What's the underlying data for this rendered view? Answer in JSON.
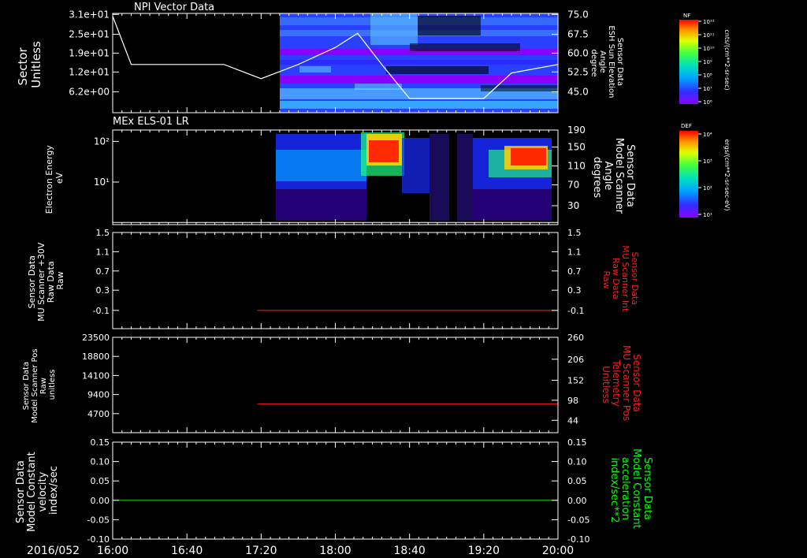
{
  "time_axis": {
    "date_label": "2016/052",
    "tick_labels": [
      "16:00",
      "16:40",
      "17:20",
      "18:00",
      "18:40",
      "19:20",
      "20:00"
    ]
  },
  "panels": [
    {
      "id": "npi",
      "title": "NPI Vector Data",
      "left_label": [
        "Sector",
        "Unitless"
      ],
      "right_label": [
        "Sensor Data",
        "ESH Sun Elevation",
        "Angle",
        "degree"
      ],
      "left_ticks": [
        "3.1e+01",
        "2.5e+01",
        "1.9e+01",
        "1.2e+01",
        "6.2e+00"
      ],
      "right_ticks": [
        "75.0",
        "67.5",
        "60.0",
        "52.5",
        "45.0"
      ],
      "colorbar": {
        "label": "NF",
        "unit": "cnts/(cm**2-sr-sec)",
        "ticks": [
          "10¹²",
          "10¹¹",
          "10¹⁰",
          "10⁹",
          "10⁸",
          "10⁷",
          "10⁶"
        ]
      }
    },
    {
      "id": "els",
      "title": "MEx ELS-01 LR",
      "left_label": [
        "Electron Energy",
        "eV"
      ],
      "right_label": [
        "Sensor Data",
        "Model Scanner",
        "Angle",
        "degrees"
      ],
      "left_ticks": [
        "10²",
        "10¹"
      ],
      "right_ticks": [
        "190",
        "150",
        "110",
        "70",
        "30"
      ],
      "colorbar": {
        "label": "DEF",
        "unit": "ergs/(cm**2-sr-sec-eV)",
        "ticks": [
          "10⁴",
          "10³",
          "10²",
          "10¹"
        ]
      }
    },
    {
      "id": "mu_int",
      "left_label": [
        "Sensor Data",
        "MU Scanner +30V",
        "Raw Data",
        "Raw"
      ],
      "right_label": [
        "Sensor Data",
        "MU Scanner Int",
        "Raw Data",
        "Raw"
      ],
      "left_ticks": [
        "1.5",
        "1.1",
        "0.7",
        "0.3",
        "-0.1"
      ],
      "right_ticks": [
        "1.5",
        "1.1",
        "0.7",
        "0.3",
        "-0.1"
      ]
    },
    {
      "id": "mu_pos",
      "left_label": [
        "Sensor Data",
        "Model Scanner Pos",
        "Raw",
        "unitless"
      ],
      "right_label": [
        "Sensor Data",
        "MU Scanner Pos",
        "Telemetry",
        "Unitless"
      ],
      "left_ticks": [
        "23500",
        "18800",
        "14100",
        "9400",
        "4700"
      ],
      "right_ticks": [
        "260",
        "206",
        "152",
        "98",
        "44"
      ]
    },
    {
      "id": "model",
      "left_label": [
        "Sensor Data",
        "Model Constant",
        "velocity",
        "index/sec"
      ],
      "right_label": [
        "Sensor Data",
        "Model Constant",
        "acceleration",
        "index/sec**2"
      ],
      "left_ticks": [
        "0.15",
        "0.10",
        "0.05",
        "0.00",
        "-0.05",
        "-0.10"
      ],
      "right_ticks": [
        "0.15",
        "0.10",
        "0.05",
        "0.00",
        "-0.05",
        "-0.10"
      ]
    }
  ],
  "colors": {
    "axes": "#ffffff",
    "red_line": "#ff2020",
    "green_line": "#00e000",
    "green_label": "#00ff00",
    "red_label": "#ff1a1a"
  },
  "chart_data": [
    {
      "type": "heatmap",
      "title": "NPI Vector Data",
      "ylabel": "Sector Unitless",
      "y2label": "Sensor Data ESH Sun Elevation Angle degree",
      "x": [
        "16:00",
        "20:00"
      ],
      "data_start": "17:22",
      "overlay_line": {
        "name": "ESH Sun Elevation Angle",
        "axis": "right",
        "ylim": [
          40,
          75
        ],
        "points": [
          [
            "16:00",
            74
          ],
          [
            "16:10",
            57
          ],
          [
            "16:30",
            57
          ],
          [
            "17:00",
            57
          ],
          [
            "17:20",
            52
          ],
          [
            "17:40",
            57
          ],
          [
            "18:00",
            63
          ],
          [
            "18:12",
            68
          ],
          [
            "18:25",
            57
          ],
          [
            "18:40",
            45
          ],
          [
            "19:20",
            45
          ],
          [
            "19:35",
            54
          ],
          [
            "20:00",
            57
          ]
        ]
      }
    },
    {
      "type": "heatmap",
      "title": "MEx ELS-01 LR",
      "ylabel": "Electron Energy eV",
      "y2label": "Sensor Data Model Scanner Angle degrees",
      "data_start": "17:20",
      "overlay_line": {
        "name": "Model Scanner Angle",
        "axis": "right",
        "ylim": [
          10,
          190
        ],
        "points": [
          [
            "16:00",
            14
          ],
          [
            "20:00",
            14
          ]
        ]
      }
    },
    {
      "type": "line",
      "ylabel": "Sensor Data MU Scanner +30V Raw Data Raw",
      "y2label": "Sensor Data MU Scanner Int Raw Data Raw",
      "ylim": [
        -0.35,
        1.5
      ],
      "series": [
        {
          "points": [
            [
              "17:18",
              0.0
            ],
            [
              "20:00",
              0.0
            ]
          ]
        }
      ]
    },
    {
      "type": "line",
      "ylabel": "Sensor Data Model Scanner Pos Raw unitless",
      "y2label": "Sensor Data MU Scanner Pos Telemetry Unitless",
      "ylim": [
        0,
        23500
      ],
      "series": [
        {
          "points": [
            [
              "17:18",
              7100
            ],
            [
              "20:00",
              7100
            ]
          ]
        }
      ]
    },
    {
      "type": "line",
      "ylabel": "Sensor Data Model Constant velocity index/sec",
      "y2label": "Sensor Data Model Constant acceleration index/sec**2",
      "ylim": [
        -0.1,
        0.15
      ],
      "series": [
        {
          "points": [
            [
              "16:00",
              0.0
            ],
            [
              "20:00",
              0.0
            ]
          ]
        }
      ]
    }
  ]
}
